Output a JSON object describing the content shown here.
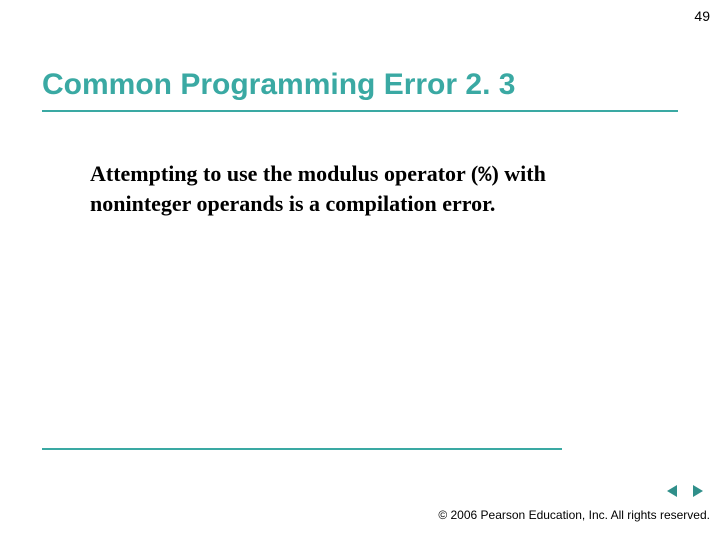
{
  "page_number": "49",
  "title": "Common Programming Error 2. 3",
  "body": {
    "pre": "Attempting to use the modulus operator (",
    "op": "%",
    "post": ") with noninteger operands is a compilation error."
  },
  "footer": "© 2006 Pearson Education, Inc.  All rights reserved.",
  "nav": {
    "prev_label": "Previous slide",
    "next_label": "Next slide"
  },
  "colors": {
    "accent": "#3aa9a3",
    "nav_arrow": "#2f8f8a"
  }
}
